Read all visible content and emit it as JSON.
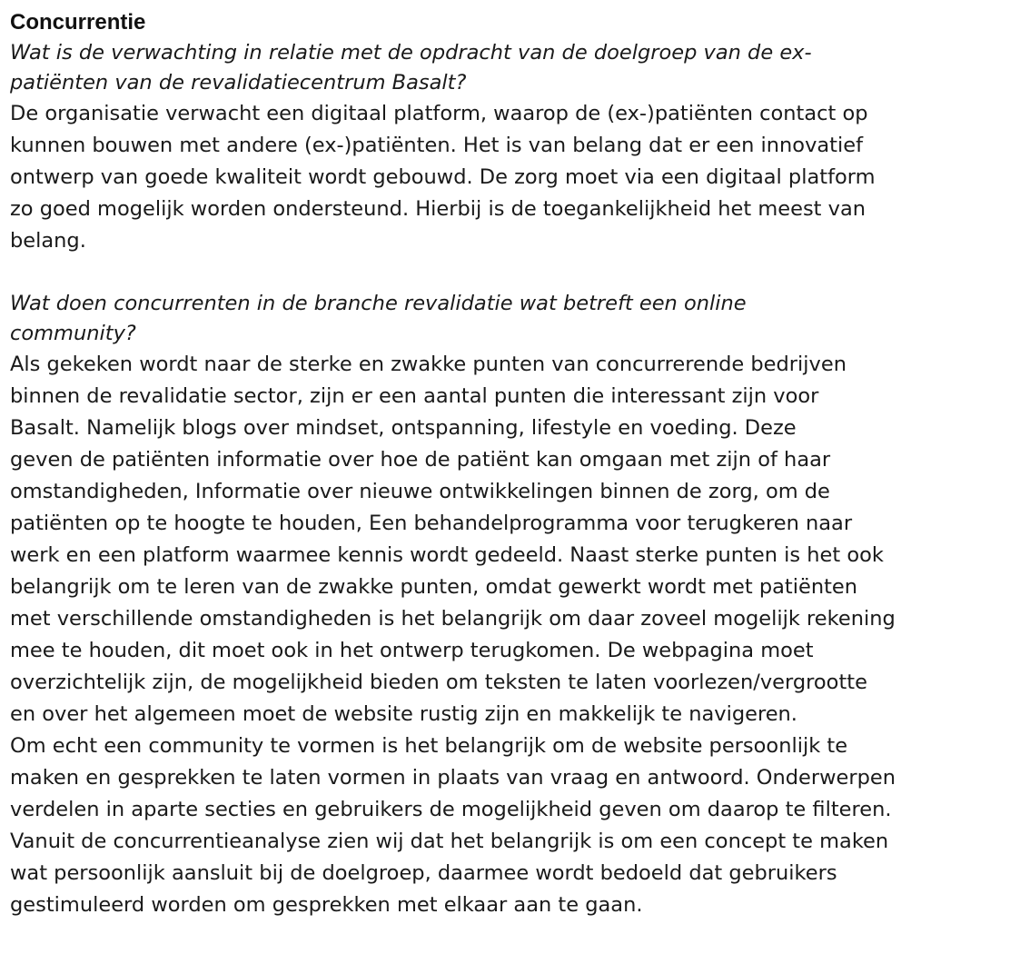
{
  "document": {
    "heading": "Concurrentie",
    "section1": {
      "question": "Wat is de verwachting in relatie met de opdracht van de doelgroep van de ex-patiënten van de revalidatiecentrum Basalt?",
      "answer_lines": [
        "De organisatie verwacht een digitaal platform, waarop de (ex-)patiënten contact op",
        "kunnen bouwen met andere (ex-)patiënten. Het is van belang dat er een innovatief",
        "ontwerp van goede kwaliteit wordt gebouwd. De zorg moet via een digitaal platform",
        "zo goed mogelijk worden ondersteund. Hierbij is de toegankelijkheid het meest van",
        "belang."
      ]
    },
    "section2": {
      "question": "Wat doen concurrenten in de branche revalidatie wat betreft een online community?",
      "answer_lines": [
        "Als gekeken wordt naar de sterke en zwakke punten van concurrerende bedrijven",
        "binnen de revalidatie sector, zijn er een aantal punten die interessant zijn voor",
        "Basalt. Namelijk blogs over mindset, ontspanning, lifestyle en voeding. Deze",
        "geven de patiënten informatie over hoe de patiënt kan omgaan met zijn of haar",
        "omstandigheden, Informatie over nieuwe ontwikkelingen binnen de zorg, om de",
        "patiënten op te hoogte te houden, Een behandelprogramma voor terugkeren naar",
        "werk en een platform waarmee kennis wordt gedeeld. Naast sterke punten is het ook",
        "belangrijk om te leren van de zwakke punten, omdat gewerkt wordt met patiënten",
        "met verschillende omstandigheden is het belangrijk om daar zoveel mogelijk rekening",
        "mee te houden, dit moet ook in het ontwerp terugkomen. De webpagina moet",
        "overzichtelijk zijn, de mogelijkheid bieden om teksten te laten voorlezen/vergrootte",
        "en over het algemeen moet de website rustig zijn en makkelijk te navigeren.",
        "Om echt een community te vormen is het belangrijk om de website persoonlijk te",
        "maken en gesprekken te laten vormen in plaats van vraag en antwoord. Onderwerpen",
        "verdelen in aparte secties en gebruikers de mogelijkheid geven om daarop te filteren.",
        "Vanuit de concurrentieanalyse zien wij dat het belangrijk is om een concept te maken",
        "wat persoonlijk aansluit bij de doelgroep, daarmee wordt bedoeld dat gebruikers",
        "gestimuleerd worden om gesprekken met elkaar aan te gaan."
      ]
    }
  }
}
